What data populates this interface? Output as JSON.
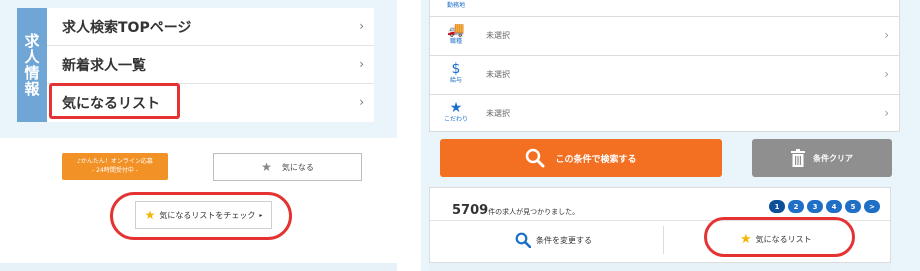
{
  "left": {
    "vertical_tab": "求人情報",
    "menu": [
      {
        "label": "求人検索TOPページ"
      },
      {
        "label": "新着求人一覧"
      },
      {
        "label": "気になるリスト"
      }
    ],
    "chevron": "›",
    "apply_button": {
      "line1": "♪かんたん！オンライン応募",
      "line2": "- 24時間受付中 -"
    },
    "favorite_button": {
      "label": "気になる",
      "icon": "star-icon"
    },
    "check_list_button": {
      "label": "気になるリストをチェック",
      "arrow": "▸",
      "icon": "star-icon"
    }
  },
  "right": {
    "top_caption": "勤務地",
    "rows": [
      {
        "icon_glyph": "🚚",
        "icon_caption": "職種",
        "value": "未選択"
      },
      {
        "icon_glyph": "$",
        "icon_caption": "給与",
        "value": "未選択"
      },
      {
        "icon_glyph": "★",
        "icon_caption": "こだわり",
        "value": "未選択"
      }
    ],
    "search_button": {
      "label": "この条件で検索する",
      "icon": "search-icon"
    },
    "clear_button": {
      "label": "条件クリア",
      "icon": "trash-icon"
    },
    "results": {
      "count": "5709",
      "count_suffix": "件の求人が見つかりました。",
      "pages": [
        "1",
        "2",
        "3",
        "4",
        "5",
        ">"
      ],
      "current_page": "1"
    },
    "change_conditions": {
      "label": "条件を変更する",
      "icon": "search-icon"
    },
    "favorites_list": {
      "label": "気になるリスト",
      "icon": "star-icon"
    }
  },
  "colors": {
    "accent_blue": "#1f6fc6",
    "highlight_red": "#e53333",
    "search_orange": "#f36f21",
    "apply_orange": "#f29125",
    "panel_bg": "#eaf4fb"
  }
}
